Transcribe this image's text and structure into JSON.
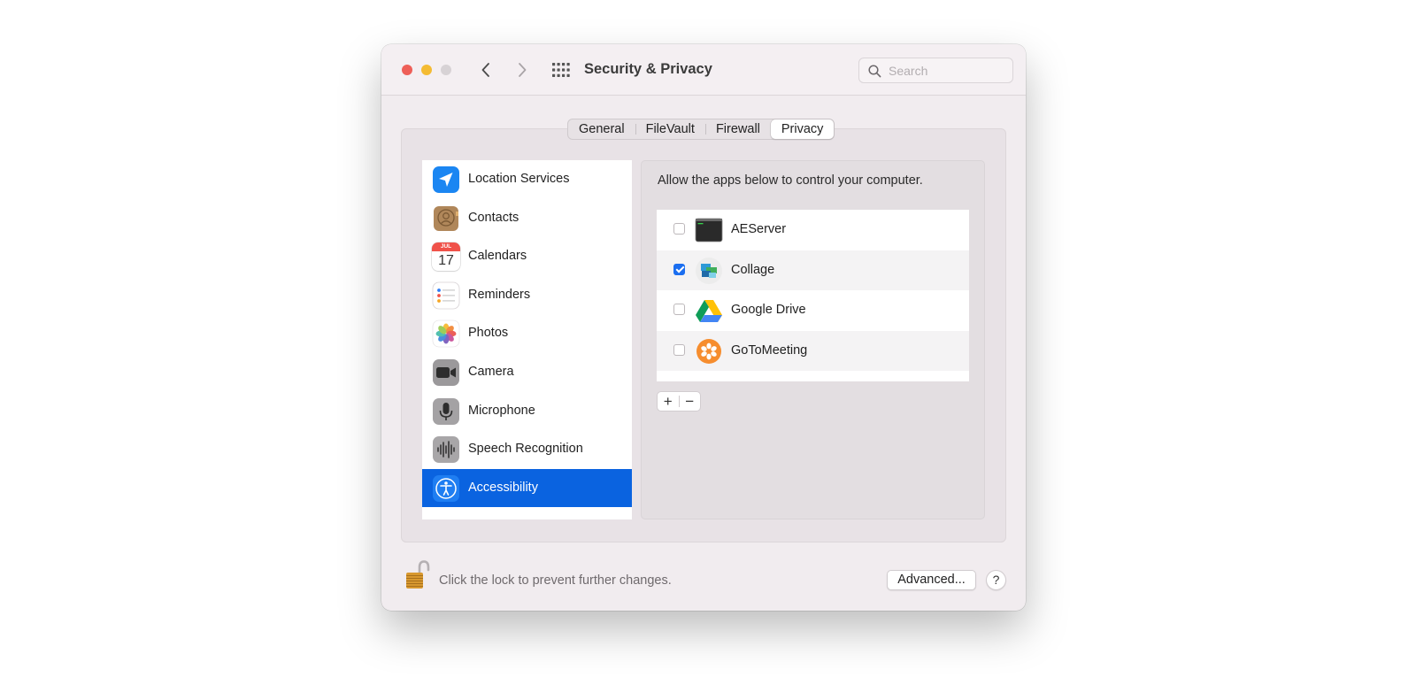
{
  "window": {
    "title": "Security & Privacy",
    "search_placeholder": "Search"
  },
  "tabs": [
    {
      "label": "General",
      "selected": false
    },
    {
      "label": "FileVault",
      "selected": false
    },
    {
      "label": "Firewall",
      "selected": false
    },
    {
      "label": "Privacy",
      "selected": true
    }
  ],
  "sidebar": {
    "items": [
      {
        "label": "Location Services",
        "icon": "location-arrow-icon"
      },
      {
        "label": "Contacts",
        "icon": "contacts-book-icon"
      },
      {
        "label": "Calendars",
        "icon": "calendar-icon",
        "icon_text": [
          "JUL",
          "17"
        ]
      },
      {
        "label": "Reminders",
        "icon": "reminders-list-icon"
      },
      {
        "label": "Photos",
        "icon": "photos-flower-icon"
      },
      {
        "label": "Camera",
        "icon": "camera-icon"
      },
      {
        "label": "Microphone",
        "icon": "microphone-icon"
      },
      {
        "label": "Speech Recognition",
        "icon": "waveform-icon"
      },
      {
        "label": "Accessibility",
        "icon": "accessibility-icon",
        "selected": true
      }
    ]
  },
  "main": {
    "description": "Allow the apps below to control your computer.",
    "apps": [
      {
        "name": "AEServer",
        "checked": false,
        "icon": "terminal-icon"
      },
      {
        "name": "Collage",
        "checked": true,
        "icon": "collage-icon"
      },
      {
        "name": "Google Drive",
        "checked": false,
        "icon": "google-drive-icon"
      },
      {
        "name": "GoToMeeting",
        "checked": false,
        "icon": "gotomeeting-icon"
      }
    ],
    "add_label": "+",
    "remove_label": "−"
  },
  "footer": {
    "lock_text": "Click the lock to prevent further changes.",
    "advanced_label": "Advanced...",
    "help_label": "?"
  },
  "colors": {
    "selection": "#0a63e0",
    "checkbox_checked": "#1b6ef0",
    "close": "#ee5f58",
    "minimize": "#f4bb33"
  }
}
